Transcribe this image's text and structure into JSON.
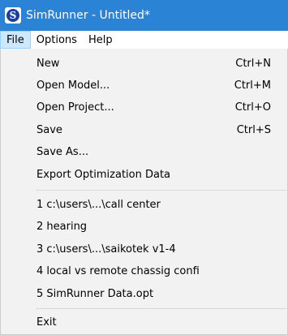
{
  "window": {
    "title": "SimRunner - Untitled*",
    "icon": "simrunner-app-icon",
    "icon_letter": "S"
  },
  "menubar": {
    "items": [
      "File",
      "Options",
      "Help"
    ]
  },
  "file_menu": {
    "items": [
      {
        "label": "New",
        "shortcut": "Ctrl+N"
      },
      {
        "label": "Open Model...",
        "shortcut": "Ctrl+M"
      },
      {
        "label": "Open Project...",
        "shortcut": "Ctrl+O"
      },
      {
        "label": "Save",
        "shortcut": "Ctrl+S"
      },
      {
        "label": "Save As...",
        "shortcut": ""
      },
      {
        "label": "Export Optimization Data",
        "shortcut": ""
      }
    ],
    "recent_files": [
      "1 c:\\users\\...\\call center",
      "2 hearing",
      "3 c:\\users\\...\\saikotek v1-4",
      "4 local vs remote chassig confi",
      "5 SimRunner Data.opt"
    ],
    "exit_label": "Exit"
  },
  "colors": {
    "titlebar": "#2b83d6",
    "menu_highlight": "#cce8ff",
    "menu_background": "#f2f2f2"
  }
}
